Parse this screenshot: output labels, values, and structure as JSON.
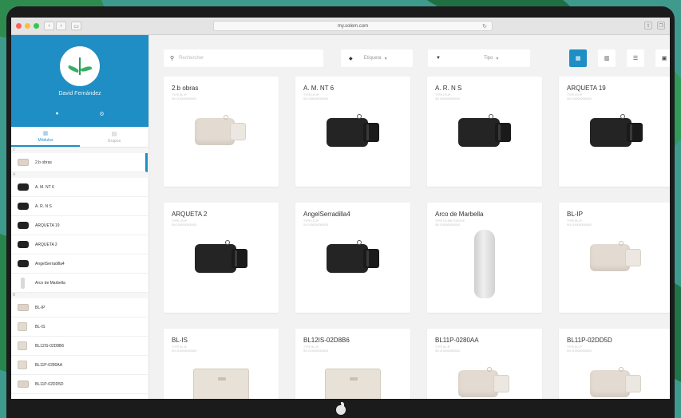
{
  "browser": {
    "url": "my.solem.com"
  },
  "sidebar": {
    "username": "David Fernández",
    "tabs": [
      {
        "label": "Módulos",
        "active": true
      },
      {
        "label": "Grupos",
        "active": false
      }
    ],
    "groups": [
      {
        "letter": "2",
        "items": [
          {
            "label": "2.b obras",
            "thumb": "beige-programmer",
            "selected": true
          }
        ]
      },
      {
        "letter": "A",
        "items": [
          {
            "label": "A. M. NT 6",
            "thumb": "black-programmer",
            "selected": false
          },
          {
            "label": "A. R. N S",
            "thumb": "black-programmer",
            "selected": false
          },
          {
            "label": "ARQUETA 19",
            "thumb": "black-programmer",
            "selected": false
          },
          {
            "label": "ARQUETA 2",
            "thumb": "black-programmer",
            "selected": false
          },
          {
            "label": "AngelSerradilla4",
            "thumb": "black-programmer",
            "selected": false
          },
          {
            "label": "Arco de Marbella",
            "thumb": "tall-gateway",
            "selected": false
          }
        ]
      },
      {
        "letter": "B",
        "items": [
          {
            "label": "BL-IP",
            "thumb": "beige-programmer",
            "selected": false
          },
          {
            "label": "BL-IS",
            "thumb": "beige-box",
            "selected": false
          },
          {
            "label": "BL12IS-02D8B6",
            "thumb": "beige-box",
            "selected": false
          },
          {
            "label": "BL11P-0280AA",
            "thumb": "beige-box",
            "selected": false
          },
          {
            "label": "BL11P-02DD5D",
            "thumb": "beige-programmer",
            "selected": false
          }
        ]
      }
    ]
  },
  "toolbar": {
    "search_placeholder": "Rechercher",
    "tag_filter": "Etiqueta",
    "type_filter": "Tipo",
    "views": [
      {
        "icon": "grid-large-icon",
        "active": true
      },
      {
        "icon": "grid-small-icon",
        "active": false
      },
      {
        "icon": "list-icon",
        "active": false
      },
      {
        "icon": "map-icon",
        "active": false
      }
    ]
  },
  "cards": [
    {
      "name": "2.b obras",
      "type": "BL-IP",
      "sn": "2100000000000",
      "image": "beige"
    },
    {
      "name": "A. M. NT 6",
      "type": "LR-IP",
      "sn": "1000000000000",
      "image": "black"
    },
    {
      "name": "A. R. N S",
      "type": "LR-IP",
      "sn": "1000000000000",
      "image": "black"
    },
    {
      "name": "ARQUETA 19",
      "type": "LR-IP",
      "sn": "1000000000000",
      "image": "black"
    },
    {
      "name": "ARQUETA 2",
      "type": "LR-IP",
      "sn": "1000000000000",
      "image": "black"
    },
    {
      "name": "AngelSerradilla4",
      "type": "LR-IP",
      "sn": "1000000000000",
      "image": "black"
    },
    {
      "name": "Arco de Marbella",
      "type": "LR-MB-TOSOOK",
      "sn": "1000000000000",
      "image": "tall"
    },
    {
      "name": "BL-IP",
      "type": "BL-IP",
      "sn": "2100000000000",
      "image": "beige"
    },
    {
      "name": "BL-IS",
      "type": "BL-IS",
      "sn": "2100000000000",
      "image": "box"
    },
    {
      "name": "BL12IS-02D8B6",
      "type": "BL-IS",
      "sn": "2100000000000",
      "image": "box"
    },
    {
      "name": "BL11P-0280AA",
      "type": "BL-IP",
      "sn": "2100000000000",
      "image": "beige"
    },
    {
      "name": "BL11P-02DD5D",
      "type": "BL-IP",
      "sn": "2100000000000",
      "image": "beige"
    }
  ]
}
